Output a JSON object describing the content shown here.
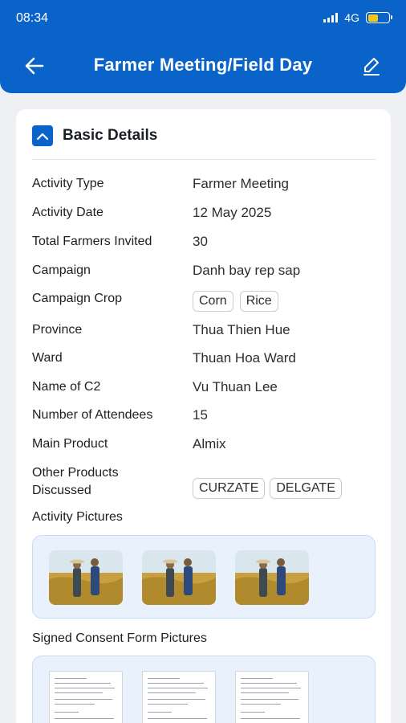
{
  "status_bar": {
    "time": "08:34",
    "network": "4G"
  },
  "header": {
    "title": "Farmer Meeting/Field Day"
  },
  "section": {
    "title": "Basic Details"
  },
  "details": {
    "activity_type": {
      "label": "Activity  Type",
      "value": "Farmer Meeting"
    },
    "activity_date": {
      "label": "Activity  Date",
      "value": "12 May 2025"
    },
    "total_farmers_invited": {
      "label": "Total Farmers Invited",
      "value": "30"
    },
    "campaign": {
      "label": "Campaign",
      "value": "Danh bay rep sap"
    },
    "campaign_crop": {
      "label": "Campaign Crop",
      "chips": [
        "Corn",
        "Rice"
      ]
    },
    "province": {
      "label": "Province",
      "value": "Thua Thien Hue"
    },
    "ward": {
      "label": "Ward",
      "value": "Thuan Hoa Ward"
    },
    "name_of_c2": {
      "label": "Name of C2",
      "value": "Vu Thuan Lee"
    },
    "number_of_attendees": {
      "label": "Number of Attendees",
      "value": "15"
    },
    "main_product": {
      "label": "Main Product",
      "value": "Almix"
    },
    "other_products": {
      "label_line1": "Other Products",
      "label_line2": "Discussed",
      "chips": [
        "CURZATE",
        "DELGATE"
      ]
    }
  },
  "activity_pictures": {
    "label": "Activity Pictures",
    "count": 3
  },
  "consent_pictures": {
    "label": "Signed Consent Form Pictures",
    "count": 3
  },
  "colors": {
    "primary": "#0a63c9",
    "picture_bg": "#e8f1fc",
    "page_bg": "#eef0f4"
  }
}
